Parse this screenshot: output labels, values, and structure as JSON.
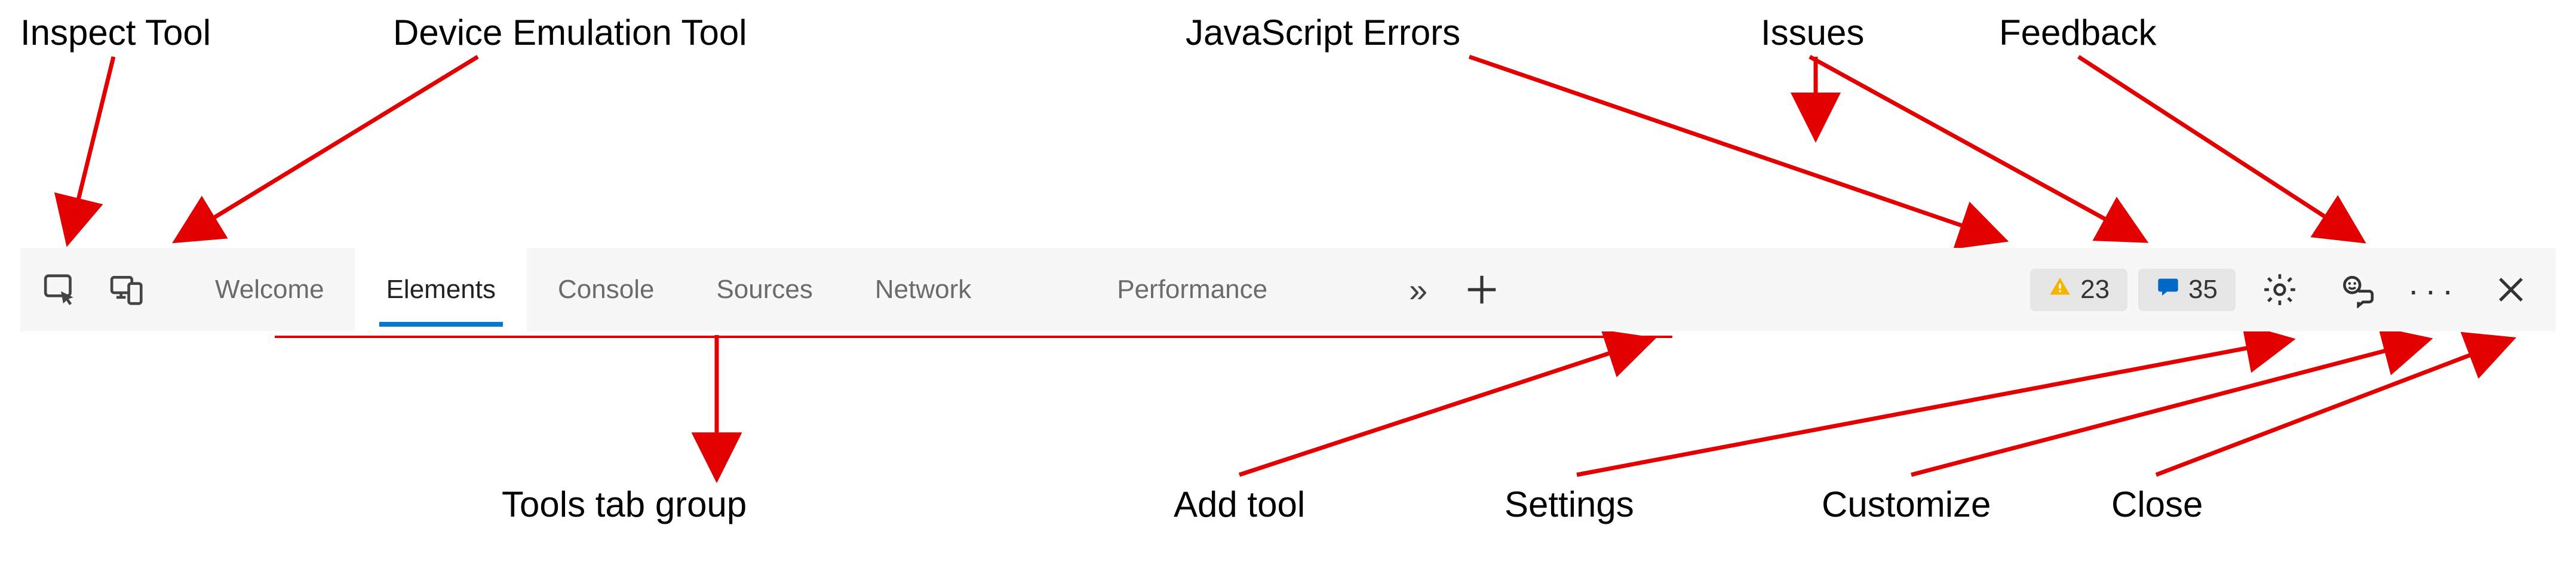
{
  "labels": {
    "inspect": "Inspect Tool",
    "device": "Device Emulation Tool",
    "jserrors": "JavaScript Errors",
    "issues": "Issues",
    "feedback": "Feedback",
    "tabgroup": "Tools tab group",
    "addtool": "Add tool",
    "settings": "Settings",
    "customize": "Customize",
    "close": "Close"
  },
  "toolbar": {
    "tabs": {
      "welcome": "Welcome",
      "elements": "Elements",
      "console": "Console",
      "sources": "Sources",
      "network": "Network",
      "performance": "Performance"
    },
    "badges": {
      "jserrors_count": "23",
      "issues_count": "35"
    }
  }
}
